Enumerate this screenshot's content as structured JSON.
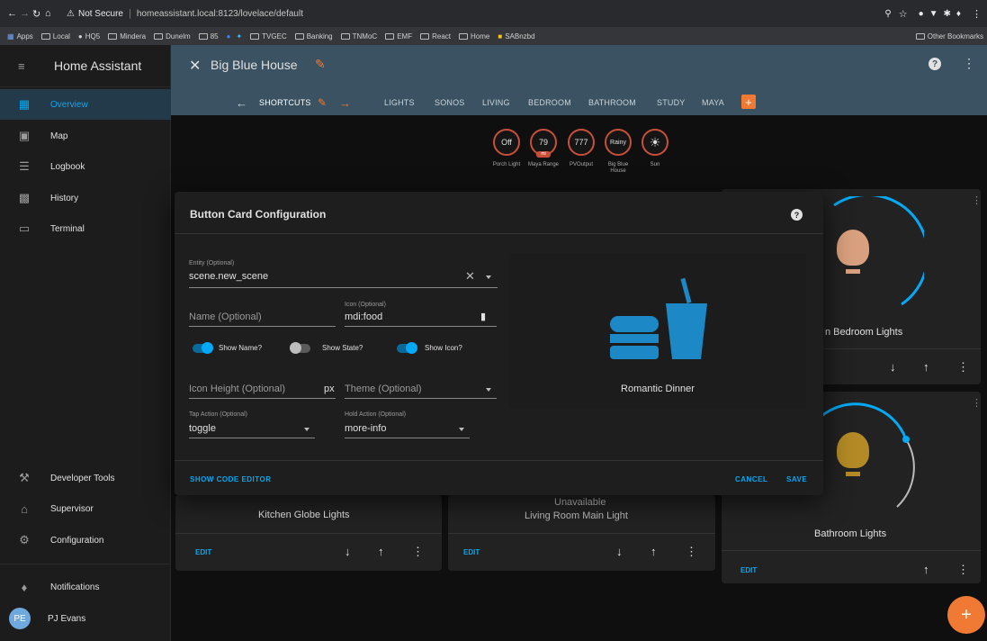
{
  "browser": {
    "security": "Not Secure",
    "url": "homeassistant.local:8123/lovelace/default",
    "bookmarks": [
      "Apps",
      "Local",
      "HQ5",
      "Mindera",
      "Dunelm",
      "85",
      "TVGEC",
      "Banking",
      "TNMoC",
      "EMF",
      "React",
      "Home",
      "SABnzbd"
    ],
    "other_bookmarks": "Other Bookmarks"
  },
  "sidebar": {
    "title": "Home Assistant",
    "items": [
      {
        "label": "Overview",
        "icon": "overview-icon"
      },
      {
        "label": "Map",
        "icon": "map-icon"
      },
      {
        "label": "Logbook",
        "icon": "logbook-icon"
      },
      {
        "label": "History",
        "icon": "history-icon"
      },
      {
        "label": "Terminal",
        "icon": "terminal-icon"
      }
    ],
    "bottom_items": [
      {
        "label": "Developer Tools",
        "icon": "hammer-icon"
      },
      {
        "label": "Supervisor",
        "icon": "supervisor-icon"
      },
      {
        "label": "Configuration",
        "icon": "gear-icon"
      }
    ],
    "notifications": "Notifications",
    "user_initials": "PE",
    "user_name": "PJ Evans"
  },
  "header": {
    "title": "Big Blue House",
    "tabs": [
      "SHORTCUTS",
      "LIGHTS",
      "SONOS",
      "LIVING",
      "BEDROOM",
      "BATHROOM",
      "STUDY",
      "MAYA"
    ]
  },
  "badges": [
    {
      "value": "Off",
      "label": "Porch Light"
    },
    {
      "value": "79",
      "label": "Maya Range",
      "sub": "mi"
    },
    {
      "value": "777",
      "label": "PVOutput"
    },
    {
      "value": "Rainy",
      "label": "Big Blue House"
    },
    {
      "value": "",
      "label": "Sun"
    }
  ],
  "cards": {
    "bedroom_label": "n Bedroom Lights",
    "kitchen_label": "Kitchen Globe Lights",
    "living_status": "Unavailable",
    "living_label": "Living Room Main Light",
    "bathroom_label": "Bathroom Lights",
    "edit_label": "EDIT"
  },
  "dialog": {
    "title": "Button Card Configuration",
    "entity_label": "Entity (Optional)",
    "entity_value": "scene.new_scene",
    "name_placeholder": "Name (Optional)",
    "icon_label": "Icon (Optional)",
    "icon_value": "mdi:food",
    "show_name": "Show Name?",
    "show_state": "Show State?",
    "show_icon": "Show Icon?",
    "icon_height_placeholder": "Icon Height (Optional)",
    "icon_height_unit": "px",
    "theme_placeholder": "Theme (Optional)",
    "tap_action_label": "Tap Action (Optional)",
    "tap_action_value": "toggle",
    "hold_action_label": "Hold Action (Optional)",
    "hold_action_value": "more-info",
    "preview_name": "Romantic Dinner",
    "show_code_editor": "SHOW CODE EDITOR",
    "cancel": "CANCEL",
    "save": "SAVE"
  },
  "colors": {
    "accent": "#03a9f4",
    "header": "#3a5261",
    "orange": "#f07a33",
    "toggle_on": "#03a9f4",
    "badge_ring": "#c8503a"
  }
}
